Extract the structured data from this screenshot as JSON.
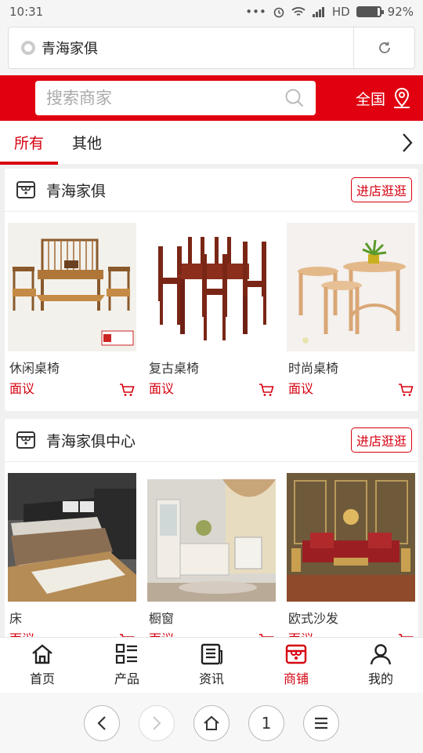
{
  "status": {
    "time": "10:31",
    "network": "HD",
    "battery": "92%",
    "battery_level": 0.92
  },
  "browser": {
    "url_title": "青海家俱"
  },
  "header": {
    "search_placeholder": "搜索商家",
    "region": "全国"
  },
  "tabs": [
    {
      "label": "所有",
      "active": true
    },
    {
      "label": "其他",
      "active": false
    }
  ],
  "shops": [
    {
      "name": "青海家俱",
      "visit_label": "进店逛逛",
      "products": [
        {
          "name": "休闲桌椅",
          "price": "面议"
        },
        {
          "name": "复古桌椅",
          "price": "面议"
        },
        {
          "name": "时尚桌椅",
          "price": "面议"
        }
      ]
    },
    {
      "name": "青海家俱中心",
      "visit_label": "进店逛逛",
      "products": [
        {
          "name": "床",
          "price": "面议"
        },
        {
          "name": "橱窗",
          "price": "面议"
        },
        {
          "name": "欧式沙发",
          "price": "面议"
        }
      ]
    }
  ],
  "bottom_nav": [
    {
      "label": "首页",
      "icon": "home-icon",
      "active": false
    },
    {
      "label": "产品",
      "icon": "list-icon",
      "active": false
    },
    {
      "label": "资讯",
      "icon": "news-icon",
      "active": false
    },
    {
      "label": "商铺",
      "icon": "store-icon",
      "active": true
    },
    {
      "label": "我的",
      "icon": "user-icon",
      "active": false
    }
  ],
  "browser_toolbar": {
    "tab_count": "1"
  },
  "colors": {
    "accent": "#d6000f",
    "header_red": "#e0000f"
  }
}
